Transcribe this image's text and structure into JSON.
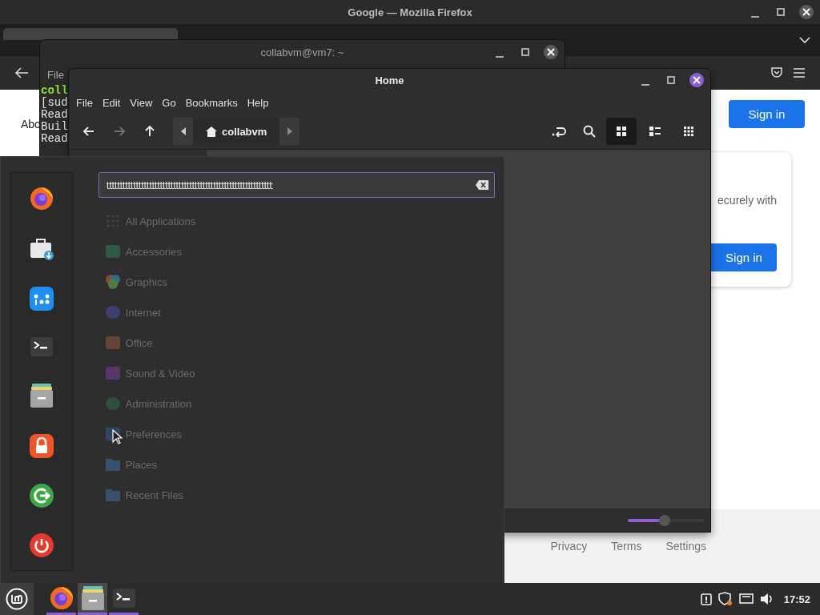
{
  "firefox": {
    "title": "Google — Mozilla Firefox",
    "tabs": [
      {
        "selected": true
      }
    ],
    "page": {
      "partial_text": "Abo",
      "sign_in_button": "Sign in",
      "card": {
        "text": "ecurely with",
        "button": "Sign in"
      },
      "footer_links": [
        "Privacy",
        "Terms",
        "Settings"
      ]
    }
  },
  "terminal": {
    "title": "collabvm@vm7: ~",
    "menu": [
      "File"
    ],
    "lines": [
      {
        "text": "coll",
        "kind": "prompt"
      },
      {
        "text": "[sud",
        "kind": "output"
      },
      {
        "text": "Read",
        "kind": "output"
      },
      {
        "text": "Buil",
        "kind": "output"
      },
      {
        "text": "Read",
        "kind": "output"
      }
    ]
  },
  "file_manager": {
    "title": "Home",
    "menu": [
      "File",
      "Edit",
      "View",
      "Go",
      "Bookmarks",
      "Help"
    ],
    "nav_buttons": [
      {
        "kind": "back",
        "disabled": false
      },
      {
        "kind": "forward",
        "disabled": true
      },
      {
        "kind": "up",
        "disabled": false
      }
    ],
    "path": "collabvm",
    "view_buttons": [
      {
        "kind": "icons",
        "selected": true
      },
      {
        "kind": "list",
        "selected": false
      },
      {
        "kind": "compact",
        "selected": false
      }
    ],
    "zoom": {
      "level": 0.48
    }
  },
  "menu": {
    "search": {
      "value": "tttttttttttttttttttttttttttttttttttttttttttttttttttttttttttttt"
    },
    "categories": [
      "All Applications",
      "Accessories",
      "Graphics",
      "Internet",
      "Office",
      "Sound & Video",
      "Administration",
      "Preferences",
      "Places",
      "Recent Files"
    ]
  },
  "taskbar": {
    "apps": [
      {
        "selected": false
      },
      {
        "selected": true
      },
      {
        "selected": false
      }
    ],
    "clock": "17:52"
  }
}
